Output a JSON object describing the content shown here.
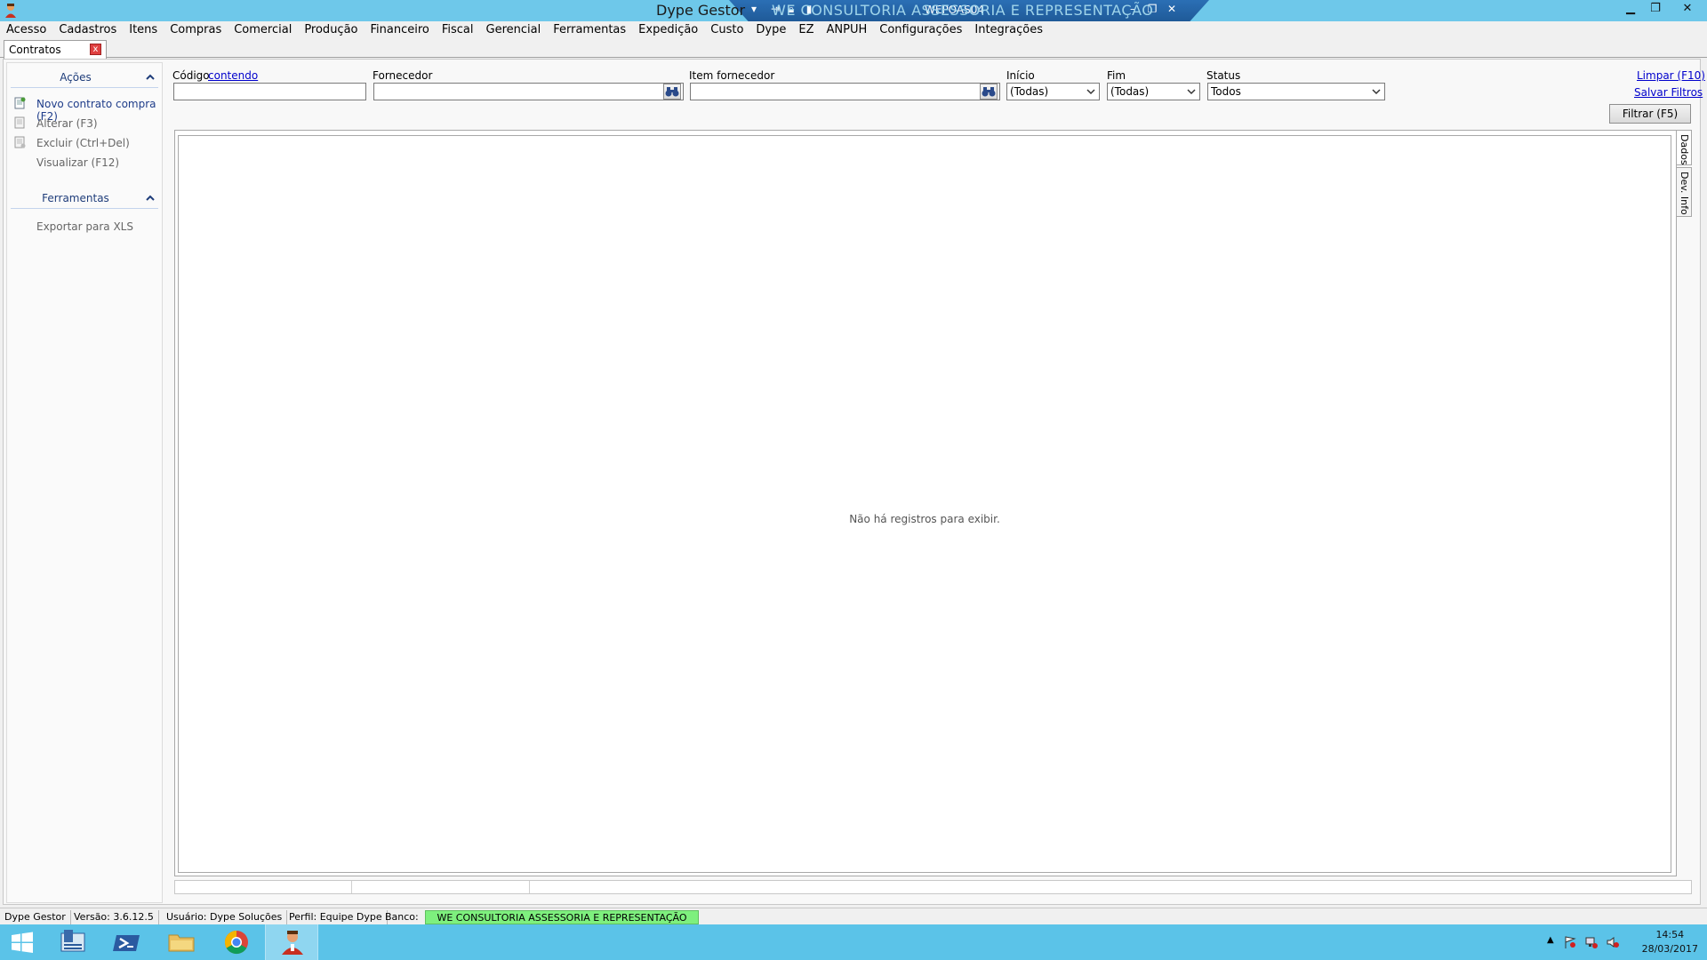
{
  "window": {
    "title": "Dype Gestor",
    "title_rest": "WE CONSULTORIA ASSESSORIA E REPRESENTAÇÃO",
    "rdp_name": "WEPOAS04"
  },
  "menu": [
    "Acesso",
    "Cadastros",
    "Itens",
    "Compras",
    "Comercial",
    "Produção",
    "Financeiro",
    "Fiscal",
    "Gerencial",
    "Ferramentas",
    "Expedição",
    "Custo",
    "Dype",
    "EZ",
    "ANPUH",
    "Configurações",
    "Integrações"
  ],
  "tab": {
    "label": "Contratos compra",
    "close": "x"
  },
  "sidebar": {
    "acoes_title": "Ações",
    "acoes": [
      {
        "label": "Novo contrato compra (F2)",
        "enabled": true,
        "icon": "new-doc-icon"
      },
      {
        "label": "Alterar (F3)",
        "enabled": false,
        "icon": "edit-doc-icon"
      },
      {
        "label": "Excluir (Ctrl+Del)",
        "enabled": false,
        "icon": "delete-doc-icon"
      },
      {
        "label": "Visualizar (F12)",
        "enabled": false,
        "icon": ""
      }
    ],
    "ferramentas_title": "Ferramentas",
    "ferramentas": [
      {
        "label": "Exportar para XLS",
        "enabled": false
      }
    ]
  },
  "filters": {
    "codigo_label": "Código",
    "codigo_mode": "contendo",
    "codigo_value": "",
    "fornecedor_label": "Fornecedor",
    "fornecedor_value": "",
    "item_label": "Item fornecedor",
    "item_value": "",
    "inicio_label": "Início",
    "inicio_value": "(Todas)",
    "fim_label": "Fim",
    "fim_value": "(Todas)",
    "status_label": "Status",
    "status_value": "Todos",
    "limpar": "Limpar (F10)",
    "salvar": "Salvar Filtros",
    "filtrar": "Filtrar (F5)"
  },
  "grid": {
    "empty_message": "Não há registros para exibir."
  },
  "side_tabs": {
    "dados": "Dados",
    "dev_info": "Dev. Info"
  },
  "status": {
    "app": "Dype Gestor",
    "version": "Versão: 3.6.12.5",
    "user": "Usuário: Dype Soluções",
    "profile": "Perfil: Equipe Dype",
    "bank_label": "Banco:",
    "bank_value": "WE CONSULTORIA ASSESSORIA E REPRESENTAÇÃO"
  },
  "taskbar": {
    "time": "14:54",
    "date": "28/03/2017"
  },
  "colors": {
    "titlebar": "#6ec8ea",
    "taskbar": "#5bc3e8",
    "bank": "#7ef07e",
    "link": "#0000cc"
  }
}
